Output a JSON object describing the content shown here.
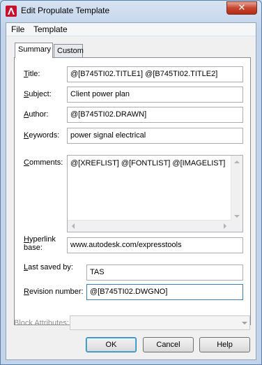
{
  "window": {
    "title": "Edit Propulate Template",
    "close_glyph": "✕"
  },
  "menu": [
    {
      "label": "File"
    },
    {
      "label": "Template"
    }
  ],
  "tabs": [
    {
      "label": "Summary",
      "active": true
    },
    {
      "label": "Custom",
      "active": false
    }
  ],
  "fields": {
    "title": {
      "label_key": "T",
      "label_rest": "itle:",
      "value": "@[B745TI02.TITLE1] @[B745TI02.TITLE2]"
    },
    "subject": {
      "label_key": "S",
      "label_rest": "ubject:",
      "value": "Client power plan"
    },
    "author": {
      "label_key": "A",
      "label_rest": "uthor:",
      "value": "@[B745TI02.DRAWN]"
    },
    "keywords": {
      "label_key": "K",
      "label_rest": "eywords:",
      "value": "power signal electrical"
    },
    "comments": {
      "label_key": "C",
      "label_rest": "omments:",
      "value": "@[XREFLIST] @[FONTLIST] @[IMAGELIST]"
    },
    "hyperlink_base": {
      "label_key": "H",
      "label_rest": "yperlink",
      "label_line2": "base:",
      "value": "www.autodesk.com/expresstools"
    },
    "last_saved_by": {
      "label_key": "L",
      "label_rest": "ast saved by:",
      "value": "TAS"
    },
    "revision_number": {
      "label_key": "R",
      "label_rest": "evision number:",
      "value": "@[B745TI02.DWGNO]"
    }
  },
  "block_attributes": {
    "label": "Block Attributes:",
    "value": ""
  },
  "buttons": {
    "ok": "OK",
    "cancel": "Cancel",
    "help": "Help"
  },
  "colors": {
    "accent": "#3c7fb1",
    "close": "#c7462f",
    "app_icon": "#c8102e"
  }
}
